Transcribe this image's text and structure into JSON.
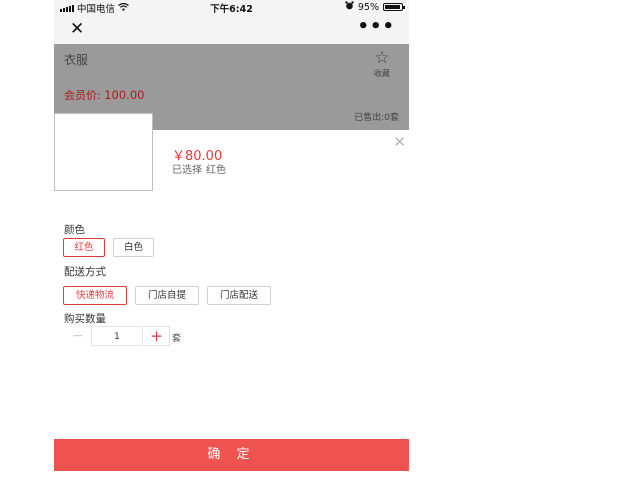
{
  "status_bar": {
    "carrier": "中国电信",
    "time": "下午6:42",
    "battery_percent": "95%",
    "battery_level": 0.95
  },
  "nav": {
    "close_icon": "close-icon",
    "more_icon": "more-icon"
  },
  "product": {
    "title": "衣服",
    "favorite_label": "收藏",
    "member_price_label": "会员价:",
    "member_price_value": "100.00",
    "sold_text": "已售出:0套"
  },
  "sheet": {
    "price": "￥80.00",
    "selected_label": "已选择",
    "selected_value": "红色",
    "color_section": "颜色",
    "colors": [
      {
        "label": "红色",
        "selected": true
      },
      {
        "label": "白色",
        "selected": false
      }
    ],
    "delivery_section": "配送方式",
    "delivery_options": [
      {
        "label": "快递物流",
        "selected": true
      },
      {
        "label": "门店自提",
        "selected": false
      },
      {
        "label": "门店配送",
        "selected": false
      }
    ],
    "quantity_section": "购买数量",
    "quantity_minus": "−",
    "quantity_value": "1",
    "quantity_plus": "+",
    "quantity_unit": "套",
    "confirm_label": "确 定"
  },
  "colors": {
    "accent": "#e3393c",
    "confirm_bg": "#ef5350",
    "overlay": "#9a9a9a"
  }
}
